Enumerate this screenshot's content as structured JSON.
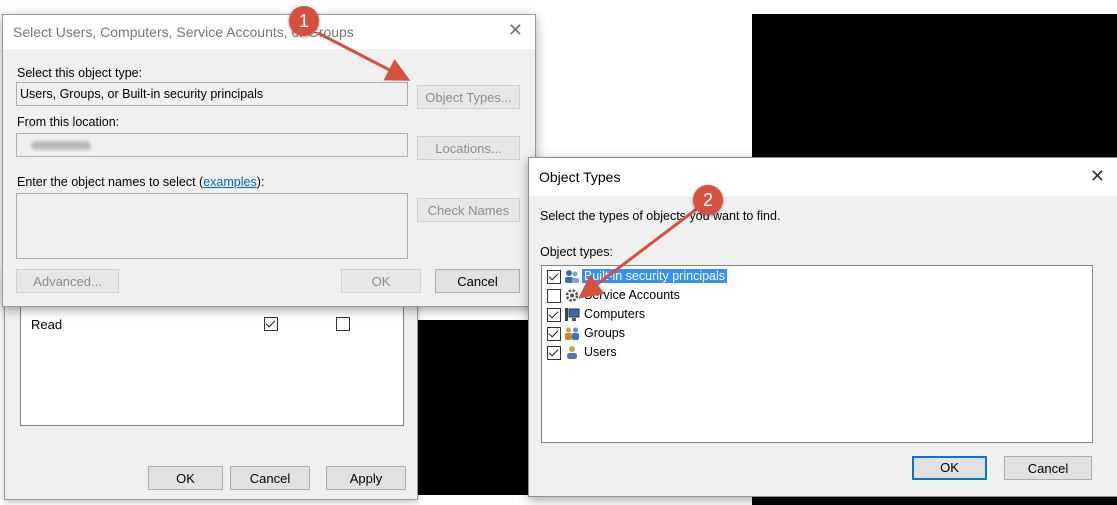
{
  "perm_dialog": {
    "rows": [
      {
        "label": "Read",
        "allow": true,
        "deny": false
      }
    ],
    "buttons": {
      "ok": "OK",
      "cancel": "Cancel",
      "apply": "Apply"
    }
  },
  "select_dialog": {
    "title": "Select Users, Computers, Service Accounts, or Groups",
    "object_type_label": "Select this object type:",
    "object_type_value": "Users, Groups, or Built-in security principals",
    "object_types_button": "Object Types...",
    "location_label": "From this location:",
    "locations_button": "Locations...",
    "enter_names_label": "Enter the object names to select (",
    "examples_link": "examples",
    "enter_names_suffix": "):",
    "check_names_button": "Check Names",
    "advanced_button": "Advanced...",
    "ok_button": "OK",
    "cancel_button": "Cancel",
    "close_glyph": "✕"
  },
  "object_types_dialog": {
    "title": "Object Types",
    "close_glyph": "✕",
    "instruction": "Select the types of objects you want to find.",
    "list_label": "Object types:",
    "items": [
      {
        "label": "Built-in security principals",
        "checked": true,
        "selected": true,
        "icon": "security-principals-icon"
      },
      {
        "label": "Service Accounts",
        "checked": false,
        "selected": false,
        "icon": "service-accounts-icon"
      },
      {
        "label": "Computers",
        "checked": true,
        "selected": false,
        "icon": "computers-icon"
      },
      {
        "label": "Groups",
        "checked": true,
        "selected": false,
        "icon": "groups-icon"
      },
      {
        "label": "Users",
        "checked": true,
        "selected": false,
        "icon": "users-icon"
      }
    ],
    "ok_button": "OK",
    "cancel_button": "Cancel"
  },
  "callouts": {
    "step1": "1",
    "step2": "2"
  },
  "colors": {
    "accent": "#0078d7",
    "callout": "#d7503d",
    "selection": "#3390ff"
  }
}
